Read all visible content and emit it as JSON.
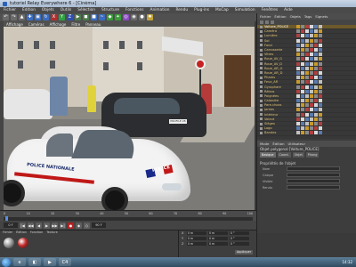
{
  "window": {
    "title": "tutoriel Relay Everywhere 6 - [Cinéma]"
  },
  "menubar": [
    "Fichier",
    "Édition",
    "Objets",
    "Outils",
    "Sélection",
    "Structure",
    "Fonctions",
    "Animation",
    "Rendu",
    "Plug-ins",
    "MoCap",
    "Simulation",
    "Fenêtres",
    "Aide"
  ],
  "toolbar": {
    "tools": [
      {
        "icon": "undo-icon",
        "glyph": "↶",
        "color": "#6a6a6a"
      },
      {
        "icon": "redo-icon",
        "glyph": "↷",
        "color": "#6a6a6a"
      },
      {
        "icon": "select-icon",
        "glyph": "▲",
        "color": "#6a6a6a"
      },
      {
        "icon": "move-icon",
        "glyph": "✚",
        "color": "#3a6dc2"
      },
      {
        "icon": "scale-icon",
        "glyph": "▣",
        "color": "#3a6dc2"
      },
      {
        "icon": "rotate-icon",
        "glyph": "↻",
        "color": "#3a6dc2"
      },
      {
        "icon": "x-axis-icon",
        "glyph": "X",
        "color": "#b03030"
      },
      {
        "icon": "y-axis-icon",
        "glyph": "Y",
        "color": "#30a040"
      },
      {
        "icon": "z-axis-icon",
        "glyph": "Z",
        "color": "#3050b0"
      },
      {
        "icon": "render-icon",
        "glyph": "▶",
        "color": "#4a7a4a"
      },
      {
        "icon": "render-settings-icon",
        "glyph": "◼",
        "color": "#4a7a4a"
      },
      {
        "icon": "cube-icon",
        "glyph": "■",
        "color": "#3a6dc2"
      },
      {
        "icon": "spline-icon",
        "glyph": "~",
        "color": "#3a6dc2"
      },
      {
        "icon": "nurbs-icon",
        "glyph": "◆",
        "color": "#3a9c3a"
      },
      {
        "icon": "array-icon",
        "glyph": "✦",
        "color": "#3a9c3a"
      },
      {
        "icon": "deformer-icon",
        "glyph": "◎",
        "color": "#8a4ac2"
      },
      {
        "icon": "scene-icon",
        "glyph": "◉",
        "color": "#6a6a6a"
      },
      {
        "icon": "camera-icon",
        "glyph": "●",
        "color": "#6a6a6a"
      },
      {
        "icon": "light-icon",
        "glyph": "✸",
        "color": "#c2a23a"
      }
    ]
  },
  "viewport": {
    "menu": [
      "Affichage",
      "Caméras",
      "Affichage",
      "Filtre",
      "Panneau"
    ]
  },
  "scene": {
    "plate_text": "PROFILE 28",
    "police_text": "POLICE",
    "door_text": "POLICE NATIONALE"
  },
  "object_manager": {
    "tabs": [
      "Fichier",
      "Édition",
      "Objets",
      "Tags",
      "Signets"
    ],
    "rows": [
      {
        "name": "Voiture_POLICE",
        "selected": true
      },
      {
        "name": "Caméra"
      },
      {
        "name": "Lumière"
      },
      {
        "name": "Sol"
      },
      {
        "name": "Fond"
      },
      {
        "name": "Carrosserie"
      },
      {
        "name": "Vitres"
      },
      {
        "name": "Roue_AV_G"
      },
      {
        "name": "Roue_AV_D"
      },
      {
        "name": "Roue_AR_G"
      },
      {
        "name": "Roue_AR_D"
      },
      {
        "name": "Phares"
      },
      {
        "name": "Feux_AR"
      },
      {
        "name": "Gyrophare"
      },
      {
        "name": "Rétros"
      },
      {
        "name": "Poignées"
      },
      {
        "name": "Calandre"
      },
      {
        "name": "Pare-chocs"
      },
      {
        "name": "Jantes"
      },
      {
        "name": "Intérieur"
      },
      {
        "name": "Volant"
      },
      {
        "name": "Sièges"
      },
      {
        "name": "Logo"
      },
      {
        "name": "Bandes"
      }
    ],
    "tag_colors": [
      "#c89a2a",
      "#8a8a8a",
      "#b04040",
      "#d8d8d8",
      "#5a7ab0",
      "#c0c0c0"
    ]
  },
  "attributes": {
    "tabs": [
      "Mode",
      "Édition",
      "Utilisateur"
    ],
    "title": "Objet polygonal [Voiture_POLICE]",
    "subtabs": [
      "Basique",
      "Coord.",
      "Objet",
      "Phong"
    ],
    "section": "Propriétés de l'objet",
    "rows": [
      "Nom",
      "Calque",
      "Visible",
      "Rendu"
    ]
  },
  "timeline": {
    "ruler": [
      "0",
      "10",
      "20",
      "30",
      "40",
      "50",
      "60",
      "70",
      "80",
      "90",
      "100"
    ]
  },
  "transport": {
    "frame_start": "0 F",
    "frame_end": "90 F",
    "buttons": [
      "|◀",
      "◀◀",
      "◀",
      "▶",
      "▶▶",
      "▶|",
      "●",
      "◆",
      "◇"
    ]
  },
  "materials": {
    "menu": [
      "Fichier",
      "Édition",
      "Fonction",
      "Texture"
    ],
    "balls": [
      "#9a9a9a",
      "#c22a2a"
    ]
  },
  "coordinates": {
    "rows": [
      {
        "axis": "X",
        "pos": "0 m",
        "size": "0 m",
        "rot": "0 °"
      },
      {
        "axis": "Y",
        "pos": "0 m",
        "size": "0 m",
        "rot": "0 °"
      },
      {
        "axis": "Z",
        "pos": "0 m",
        "size": "0 m",
        "rot": "0 °"
      }
    ],
    "apply_label": "Appliquer"
  },
  "taskbar": {
    "items": [
      "e",
      "◧",
      "▶",
      "C4"
    ],
    "clock": "14:32"
  }
}
